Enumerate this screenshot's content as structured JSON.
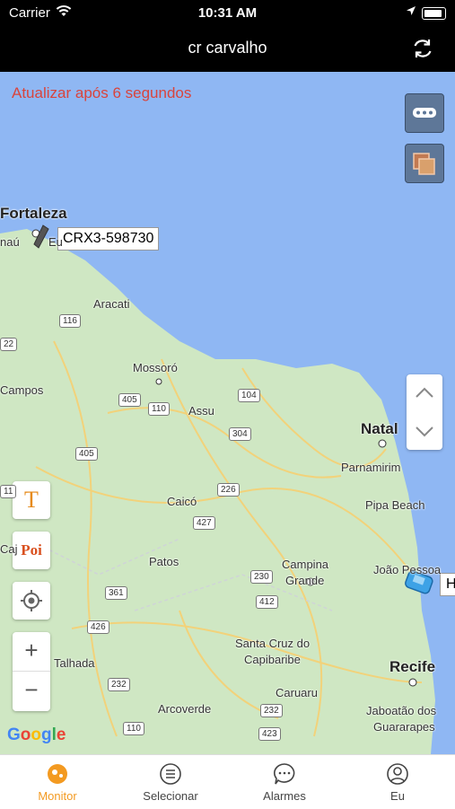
{
  "status": {
    "carrier": "Carrier",
    "time": "10:31 AM"
  },
  "nav": {
    "title": "cr carvalho"
  },
  "map": {
    "countdown": "Atualizar após 6 segundos",
    "vehicle_label": "CRX3-598730",
    "vehicle2_label": "H",
    "google": "Google",
    "text_tool": "T",
    "poi_tool": "Poi",
    "zoom_in": "+",
    "zoom_out": "−",
    "cities": [
      {
        "name": "Fortaleza",
        "big": true
      },
      {
        "name": "Aracati"
      },
      {
        "name": "Mossoró"
      },
      {
        "name": "Assu"
      },
      {
        "name": "Natal",
        "big": true
      },
      {
        "name": "Parnamirim"
      },
      {
        "name": "Pipa Beach"
      },
      {
        "name": "Caicó"
      },
      {
        "name": "Patos"
      },
      {
        "name": "Campina"
      },
      {
        "name": "Grande"
      },
      {
        "name": "João Pessoa"
      },
      {
        "name": "Santa Cruz do"
      },
      {
        "name": "Capibaribe"
      },
      {
        "name": "Caruaru"
      },
      {
        "name": "Recife",
        "big": true
      },
      {
        "name": "Jaboatão dos"
      },
      {
        "name": "Guararapes"
      },
      {
        "name": "Talhada"
      },
      {
        "name": "Arcoverde"
      },
      {
        "name": "Campos"
      },
      {
        "name": "Caj"
      },
      {
        "name": "Cajazeiras"
      },
      {
        "name": "naú"
      },
      {
        "name": "Eu"
      }
    ],
    "roads": [
      "116",
      "22",
      "405",
      "110",
      "104",
      "304",
      "405",
      "226",
      "427",
      "230",
      "412",
      "361",
      "426",
      "232",
      "232",
      "110",
      "423",
      "11"
    ]
  },
  "tabs": [
    {
      "label": "Monitor",
      "active": true
    },
    {
      "label": "Selecionar"
    },
    {
      "label": "Alarmes"
    },
    {
      "label": "Eu"
    }
  ],
  "colors": {
    "accent": "#f39a21",
    "countdown": "#d9443c",
    "sea": "#8fb7f3",
    "land": "#cfe7c3"
  }
}
